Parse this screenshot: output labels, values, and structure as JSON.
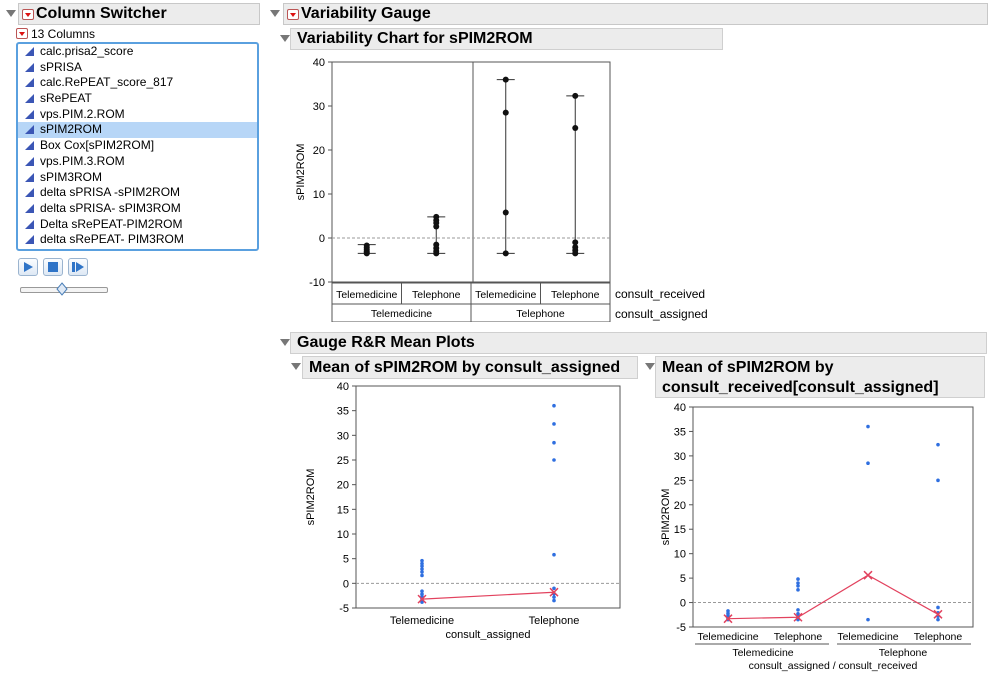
{
  "column_switcher": {
    "title": "Column Switcher",
    "count_label": "13 Columns",
    "columns": [
      "calc.prisa2_score",
      "sPRISA",
      "calc.RePEAT_score_817",
      "sRePEAT",
      "vps.PIM.2.ROM",
      "sPIM2ROM",
      "Box Cox[sPIM2ROM]",
      "vps.PIM.3.ROM",
      "sPIM3ROM",
      "delta sPRISA -sPIM2ROM",
      "delta sPRISA- sPIM3ROM",
      "Delta sRePEAT-PIM2ROM",
      "delta sRePEAT- PIM3ROM"
    ],
    "selected": "sPIM2ROM",
    "controls": [
      "play",
      "stop",
      "step"
    ]
  },
  "variability": {
    "title": "Variability Gauge",
    "chart_title": "Variability Chart for sPIM2ROM",
    "rr_title": "Gauge R&R Mean Plots"
  },
  "chart_data": [
    {
      "type": "scatter",
      "title": "Variability Chart for sPIM2ROM",
      "ylabel": "sPIM2ROM",
      "ylim": [
        -10,
        40
      ],
      "yticks": [
        -10,
        0,
        10,
        20,
        30,
        40
      ],
      "grid": false,
      "reference_line": 0,
      "x_labels": [
        "Telemedicine",
        "Telephone",
        "Telemedicine",
        "Telephone"
      ],
      "group_labels": [
        "Telemedicine",
        "Telephone"
      ],
      "row_labels": [
        "consult_received",
        "consult_assigned"
      ],
      "cells": [
        {
          "consult_assigned": "Telemedicine",
          "consult_received": "Telemedicine",
          "min": -3.5,
          "max": -1.5,
          "points": [
            -1.7,
            -2.2,
            -2.6,
            -3.0,
            -3.3,
            -3.5
          ]
        },
        {
          "consult_assigned": "Telemedicine",
          "consult_received": "Telephone",
          "min": -3.5,
          "max": 4.8,
          "points": [
            4.8,
            4.0,
            3.4,
            2.6,
            -1.5,
            -2.3,
            -3.0,
            -3.5
          ]
        },
        {
          "consult_assigned": "Telephone",
          "consult_received": "Telemedicine",
          "min": -3.5,
          "max": 36,
          "points": [
            36,
            28.5,
            5.8,
            -3.5
          ]
        },
        {
          "consult_assigned": "Telephone",
          "consult_received": "Telephone",
          "min": -3.5,
          "max": 32.3,
          "points": [
            32.3,
            25,
            -1,
            -2.1,
            -2.8,
            -3.5
          ]
        }
      ]
    },
    {
      "type": "line",
      "title": "Mean of sPIM2ROM by consult_assigned",
      "ylabel": "sPIM2ROM",
      "xlabel": "consult_assigned",
      "ylim": [
        -5,
        40
      ],
      "yticks": [
        -5,
        0,
        5,
        10,
        15,
        20,
        25,
        30,
        35,
        40
      ],
      "reference_line": 0,
      "categories": [
        "Telemedicine",
        "Telephone"
      ],
      "means": [
        -3.2,
        -1.8
      ],
      "points": [
        [
          4.6,
          4.0,
          3.5,
          2.9,
          2.3,
          1.6,
          -1.6,
          -2.2,
          -2.7,
          -3.1,
          -3.5,
          -3.8
        ],
        [
          36,
          32.3,
          28.5,
          25,
          5.8,
          -1.0,
          -2.1,
          -2.8,
          -3.5
        ]
      ]
    },
    {
      "type": "line",
      "title": "Mean of sPIM2ROM by consult_received[consult_assigned]",
      "ylabel": "sPIM2ROM",
      "xlabel": "consult_assigned / consult_received",
      "ylim": [
        -5,
        40
      ],
      "yticks": [
        -5,
        0,
        5,
        10,
        15,
        20,
        25,
        30,
        35,
        40
      ],
      "reference_line": 0,
      "categories": [
        "Telemedicine",
        "Telephone",
        "Telemedicine",
        "Telephone"
      ],
      "group_labels": [
        "Telemedicine",
        "Telephone"
      ],
      "means": [
        -3.3,
        -3.0,
        5.6,
        -2.4
      ],
      "points": [
        [
          -1.7,
          -2.2,
          -2.6,
          -3.0,
          -3.3,
          -3.5
        ],
        [
          4.8,
          4.0,
          3.4,
          2.6,
          -1.5,
          -2.3,
          -3.0,
          -3.5
        ],
        [
          36,
          28.5,
          -3.5
        ],
        [
          32.3,
          25,
          -1,
          -2.1,
          -2.8,
          -3.5
        ]
      ]
    }
  ],
  "colors": {
    "point": "#2f6fe0",
    "mean": "#e2425e",
    "ref": "#999999",
    "header": "#ececec",
    "selection": "#b7d6f7"
  }
}
